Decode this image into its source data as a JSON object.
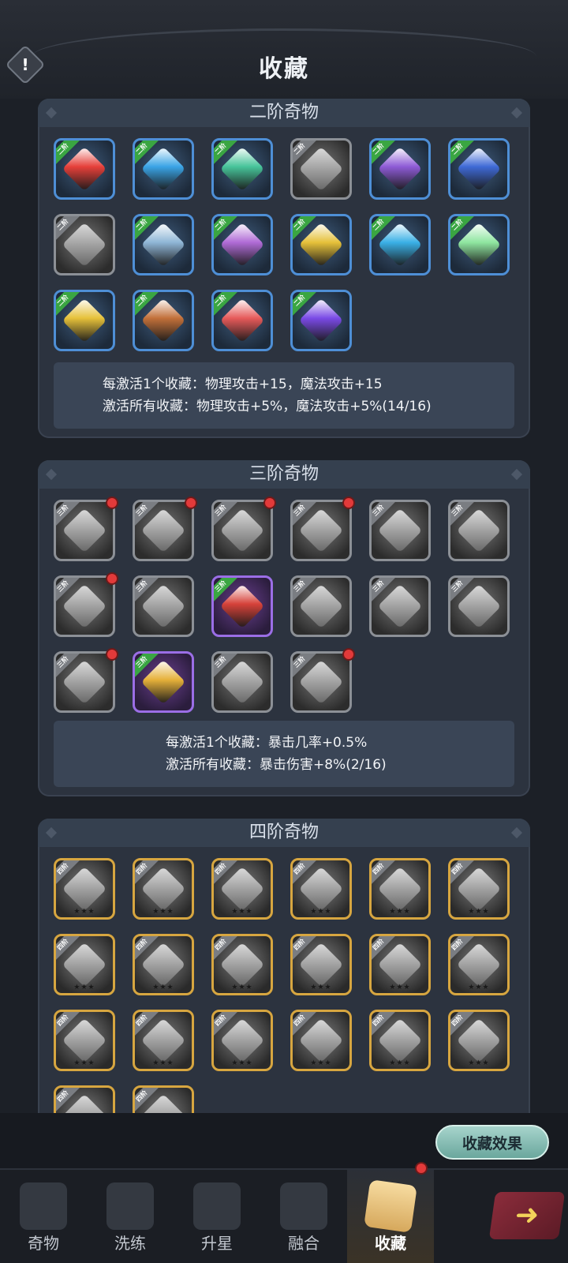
{
  "header": {
    "title": "收藏",
    "info_icon": "!"
  },
  "sections": [
    {
      "title": "二阶奇物",
      "effects": [
        "每激活1个收藏：物理攻击+15，魔法攻击+15",
        "激活所有收藏：物理攻击+5%，魔法攻击+5%(14/16)"
      ],
      "items": [
        {
          "style": "color",
          "badge": "二阶",
          "badge_color": "green",
          "hue": "#e6403a"
        },
        {
          "style": "color",
          "badge": "二阶",
          "badge_color": "green",
          "hue": "#3aa4e6"
        },
        {
          "style": "color",
          "badge": "二阶",
          "badge_color": "green",
          "hue": "#47c49a"
        },
        {
          "style": "gray",
          "badge": "二阶",
          "badge_color": "gray",
          "hue": "#cfcfcf"
        },
        {
          "style": "color",
          "badge": "二阶",
          "badge_color": "green",
          "hue": "#8e5bd6"
        },
        {
          "style": "color",
          "badge": "二阶",
          "badge_color": "green",
          "hue": "#3f6ad6"
        },
        {
          "style": "gray",
          "badge": "二阶",
          "badge_color": "gray",
          "hue": "#d0d0d0"
        },
        {
          "style": "color",
          "badge": "二阶",
          "badge_color": "green",
          "hue": "#8fb6d6"
        },
        {
          "style": "color",
          "badge": "二阶",
          "badge_color": "green",
          "hue": "#b06bd6"
        },
        {
          "style": "color",
          "badge": "二阶",
          "badge_color": "green",
          "hue": "#e6c13a"
        },
        {
          "style": "color",
          "badge": "二阶",
          "badge_color": "green",
          "hue": "#3ab0e6"
        },
        {
          "style": "color",
          "badge": "二阶",
          "badge_color": "green",
          "hue": "#8fe6a0"
        },
        {
          "style": "color",
          "badge": "二阶",
          "badge_color": "green",
          "hue": "#e6c13a"
        },
        {
          "style": "color",
          "badge": "二阶",
          "badge_color": "green",
          "hue": "#c2703a"
        },
        {
          "style": "color",
          "badge": "二阶",
          "badge_color": "green",
          "hue": "#e65a5a"
        },
        {
          "style": "color",
          "badge": "二阶",
          "badge_color": "green",
          "hue": "#7a4ae6"
        }
      ]
    },
    {
      "title": "三阶奇物",
      "effects": [
        "每激活1个收藏：暴击几率+0.5%",
        "激活所有收藏：暴击伤害+8%(2/16)"
      ],
      "items": [
        {
          "style": "gray",
          "badge": "三阶",
          "badge_color": "gray",
          "dot": true
        },
        {
          "style": "gray",
          "badge": "三阶",
          "badge_color": "gray",
          "dot": true
        },
        {
          "style": "gray",
          "badge": "三阶",
          "badge_color": "gray",
          "dot": true
        },
        {
          "style": "gray",
          "badge": "三阶",
          "badge_color": "gray",
          "dot": true
        },
        {
          "style": "gray",
          "badge": "三阶",
          "badge_color": "gray"
        },
        {
          "style": "gray",
          "badge": "三阶",
          "badge_color": "gray"
        },
        {
          "style": "gray",
          "badge": "三阶",
          "badge_color": "gray",
          "dot": true
        },
        {
          "style": "gray",
          "badge": "三阶",
          "badge_color": "gray"
        },
        {
          "style": "purple",
          "badge": "三阶",
          "badge_color": "green",
          "hue": "#d6423a"
        },
        {
          "style": "gray",
          "badge": "三阶",
          "badge_color": "gray"
        },
        {
          "style": "gray",
          "badge": "三阶",
          "badge_color": "gray"
        },
        {
          "style": "gray",
          "badge": "三阶",
          "badge_color": "gray"
        },
        {
          "style": "gray",
          "badge": "三阶",
          "badge_color": "gray",
          "dot": true
        },
        {
          "style": "purple",
          "badge": "三阶",
          "badge_color": "green",
          "hue": "#e6b13a"
        },
        {
          "style": "gray",
          "badge": "三阶",
          "badge_color": "gray"
        },
        {
          "style": "gray",
          "badge": "三阶",
          "badge_color": "gray",
          "dot": true
        }
      ]
    },
    {
      "title": "四阶奇物",
      "items_count": 20,
      "badge": "四阶",
      "stars": "★★★"
    }
  ],
  "effect_button": "收藏效果",
  "nav": [
    {
      "label": "奇物",
      "icon": "relic-icon"
    },
    {
      "label": "洗练",
      "icon": "refine-icon"
    },
    {
      "label": "升星",
      "icon": "star-up-icon"
    },
    {
      "label": "融合",
      "icon": "fusion-icon"
    },
    {
      "label": "收藏",
      "icon": "collection-icon",
      "active": true,
      "dot": true
    }
  ],
  "next_arrow": "➜"
}
